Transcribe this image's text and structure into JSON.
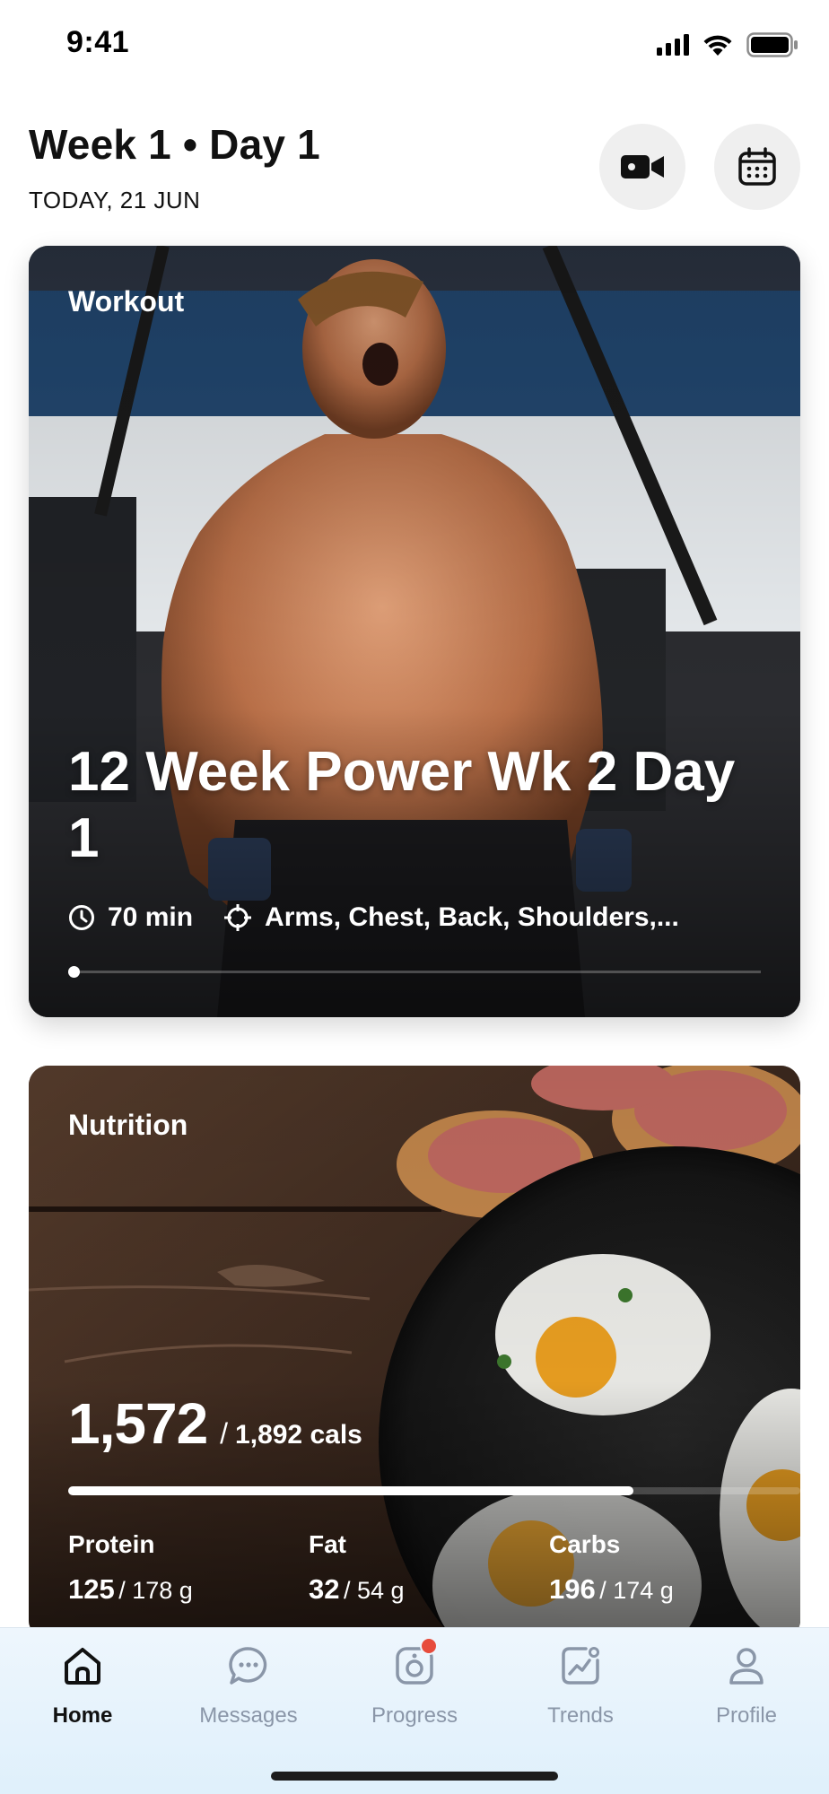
{
  "status_bar": {
    "time": "9:41"
  },
  "header": {
    "title": "Week 1 • Day 1",
    "date": "TODAY, 21 JUN",
    "video_icon": "video-camera-icon",
    "calendar_icon": "calendar-icon"
  },
  "workout": {
    "label": "Workout",
    "title": "12 Week Power Wk 2 Day 1",
    "duration": "70 min",
    "muscles": "Arms, Chest, Back, Shoulders,...",
    "progress": 0.0
  },
  "nutrition": {
    "label": "Nutrition",
    "calories": "1,572",
    "separator": "/",
    "calories_goal": "1,892 cals",
    "calories_progress": 0.83,
    "macros": [
      {
        "label": "Protein",
        "value": "125",
        "goal": "/ 178 g"
      },
      {
        "label": "Fat",
        "value": "32",
        "goal": "/ 54 g"
      },
      {
        "label": "Carbs",
        "value": "196",
        "goal": "/ 174 g"
      }
    ]
  },
  "tab_bar": {
    "tabs": [
      {
        "label": "Home",
        "icon": "home-icon",
        "active": true
      },
      {
        "label": "Messages",
        "icon": "chat-bubble-icon",
        "active": false
      },
      {
        "label": "Progress",
        "icon": "camera-icon",
        "active": false,
        "badge": true
      },
      {
        "label": "Trends",
        "icon": "trend-chart-icon",
        "active": false
      },
      {
        "label": "Profile",
        "icon": "person-icon",
        "active": false
      }
    ]
  },
  "colors": {
    "badge": "#e74c3c",
    "tab_inactive": "#8a96a8",
    "tab_active": "#111111"
  }
}
